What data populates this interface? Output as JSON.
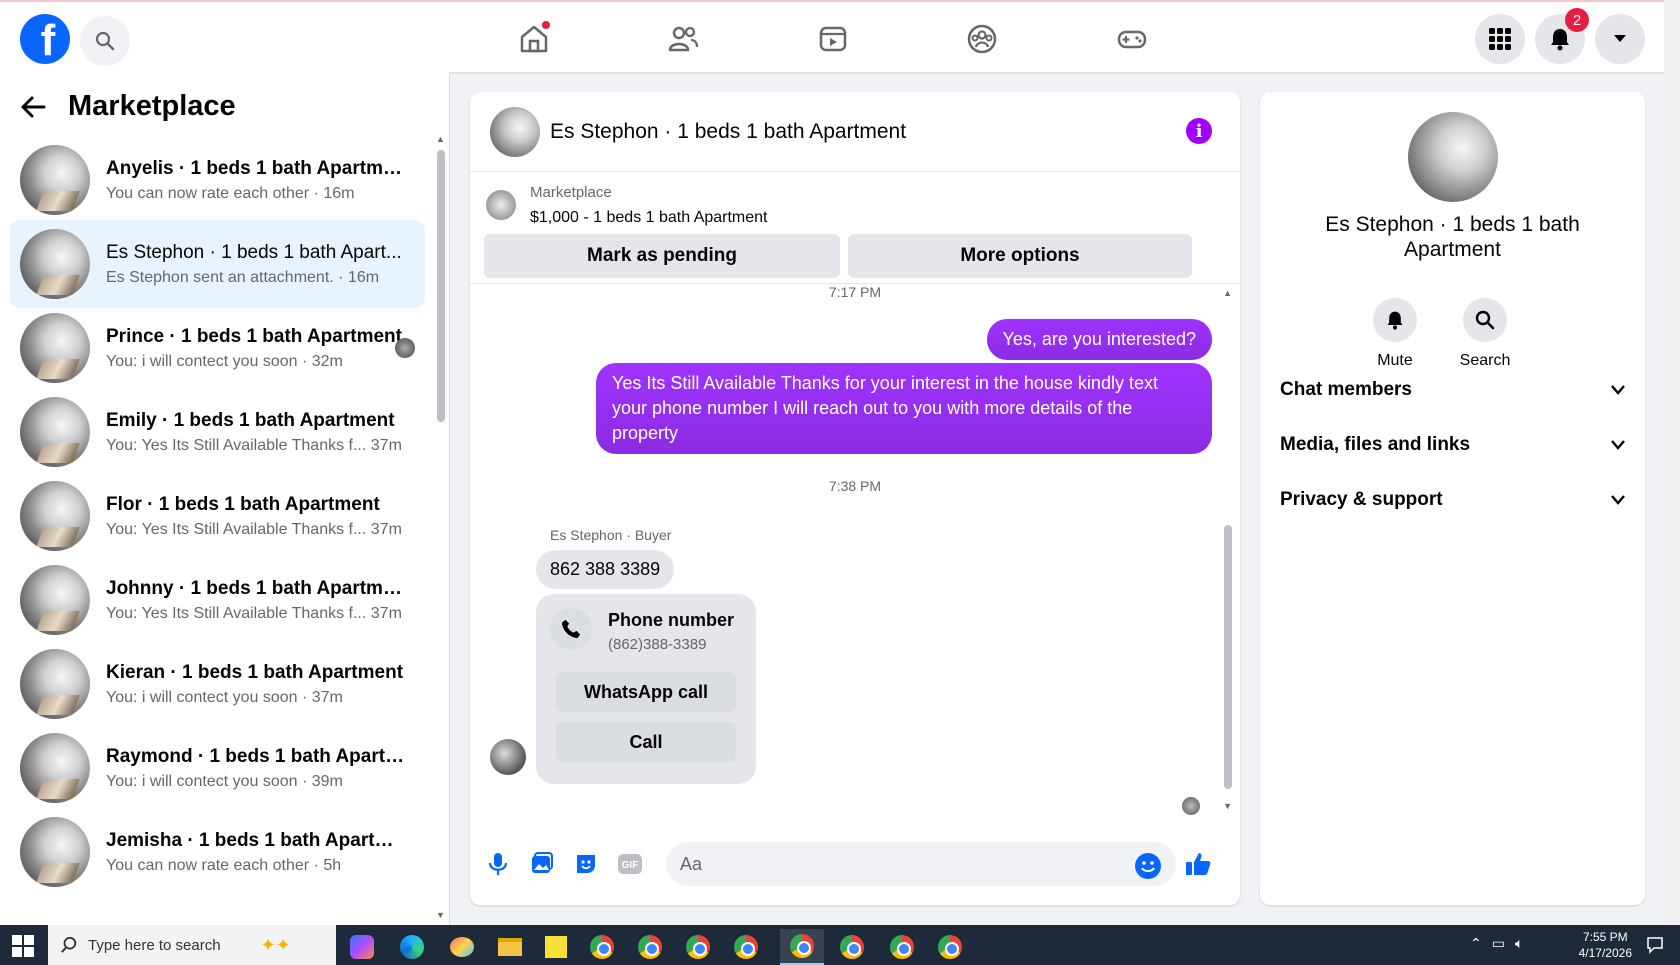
{
  "nav": {
    "logo_letter": "f",
    "notification_count": "2",
    "icons": [
      "home-icon",
      "friends-icon",
      "watch-icon",
      "groups-icon",
      "gaming-icon"
    ]
  },
  "sidebar": {
    "title": "Marketplace",
    "conversations": [
      {
        "name": "Anyelis · 1 beds 1 bath Apartment",
        "sub": "You can now rate each other · 16m"
      },
      {
        "name": "Es Stephon · 1 beds 1 bath Apart...",
        "sub": "Es Stephon sent an attachment. · 16m"
      },
      {
        "name": "Prince · 1 beds 1 bath Apartment",
        "sub": "You: i will contect you soon · 32m"
      },
      {
        "name": "Emily · 1 beds 1 bath Apartment",
        "sub": "You: Yes Its Still Available Thanks f...  37m"
      },
      {
        "name": "Flor · 1 beds 1 bath Apartment",
        "sub": "You: Yes Its Still Available Thanks f...  37m"
      },
      {
        "name": "Johnny · 1 beds 1 bath Apartment",
        "sub": "You: Yes Its Still Available Thanks f...  37m"
      },
      {
        "name": "Kieran · 1 beds 1 bath Apartment",
        "sub": "You: i will contect you soon · 37m"
      },
      {
        "name": "Raymond · 1 beds 1 bath Apartm...",
        "sub": "You: i will contect you soon · 39m"
      },
      {
        "name": "Jemisha · 1 beds 1 bath Apartment",
        "sub": "You can now rate each other · 5h"
      }
    ]
  },
  "chat": {
    "title": "Es Stephon · 1 beds 1 bath Apartment",
    "listing": {
      "source": "Marketplace",
      "price_line": "$1,000 - 1 beds 1 bath Apartment",
      "btn_pending": "Mark as pending",
      "btn_more": "More options"
    },
    "messages": {
      "time1": "7:17 PM",
      "out1": "Yes, are you interested?",
      "out2": "Yes Its Still Available Thanks for your interest in the house kindly text your phone number I will reach out to you with more details of the property",
      "time2": "7:38 PM",
      "sender_label": "Es Stephon · Buyer",
      "in1": "862 388 3389",
      "card_title": "Phone number",
      "card_number": "(862)388-3389",
      "card_btn_whatsapp": "WhatsApp call",
      "card_btn_call": "Call"
    },
    "composer": {
      "placeholder": "Aa"
    }
  },
  "info_panel": {
    "name": "Es Stephon · 1 beds 1 bath Apartment",
    "mute_label": "Mute",
    "search_label": "Search",
    "sections": [
      "Chat members",
      "Media, files and links",
      "Privacy & support"
    ]
  },
  "taskbar": {
    "search_placeholder": "Type here to search",
    "time": "7:55 PM",
    "date": "4/17/2026"
  },
  "colors": {
    "brand": "#0866ff",
    "accent_purple": "#a033ff",
    "badge_red": "#e41e3f"
  }
}
